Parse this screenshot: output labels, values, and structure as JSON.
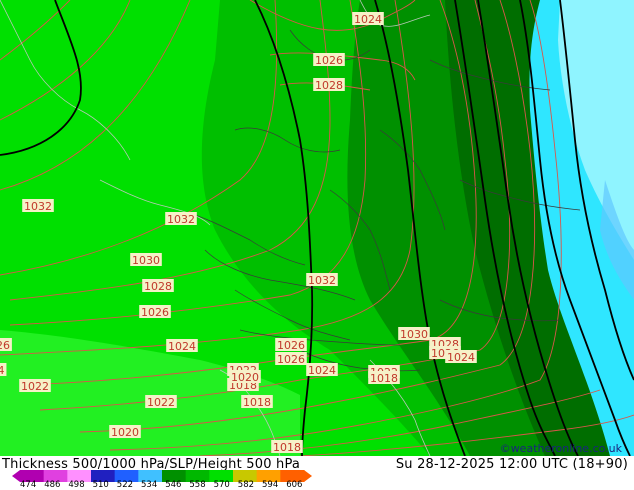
{
  "footer": {
    "left_title": "Thickness 500/1000 hPa/SLP/Height 500 hPa",
    "right_title": "Su 28-12-2025 12:00 UTC (18+90)",
    "credit": "©weatheronline.co.uk",
    "scale_ticks": [
      "474",
      "486",
      "498",
      "510",
      "522",
      "534",
      "546",
      "558",
      "570",
      "582",
      "594",
      "606"
    ],
    "scale_colors": [
      "#b000b0",
      "#e040e0",
      "#ff90ff",
      "#2020c0",
      "#2060ff",
      "#40c0ff",
      "#009000",
      "#00b800",
      "#00e000",
      "#c8c800",
      "#ffa000",
      "#ff6000"
    ]
  },
  "map": {
    "isobar_labels": [
      {
        "text": "1024",
        "key": "a"
      },
      {
        "text": "1026",
        "key": "b"
      },
      {
        "text": "1028",
        "key": "c"
      },
      {
        "text": "1032",
        "key": "d"
      },
      {
        "text": "1032",
        "key": "e"
      },
      {
        "text": "1030",
        "key": "f"
      },
      {
        "text": "1028",
        "key": "g"
      },
      {
        "text": "1026",
        "key": "h"
      },
      {
        "text": "1032",
        "key": "i"
      },
      {
        "text": "1024",
        "key": "j"
      },
      {
        "text": "1026",
        "key": "k"
      },
      {
        "text": "1026",
        "key": "l"
      },
      {
        "text": "1024",
        "key": "m"
      },
      {
        "text": "1022",
        "key": "n"
      },
      {
        "text": "1018",
        "key": "o"
      },
      {
        "text": "1022",
        "key": "p"
      },
      {
        "text": "1018",
        "key": "q"
      },
      {
        "text": "1020",
        "key": "r"
      },
      {
        "text": "1018",
        "key": "s"
      },
      {
        "text": "1022",
        "key": "t"
      },
      {
        "text": "1030",
        "key": "u"
      },
      {
        "text": "1028",
        "key": "v"
      },
      {
        "text": "1026",
        "key": "w"
      },
      {
        "text": "1024",
        "key": "x"
      },
      {
        "text": "1022",
        "key": "y"
      },
      {
        "text": "1020",
        "key": "z"
      },
      {
        "text": "1018",
        "key": "aa"
      },
      {
        "text": "26",
        "key": "ab"
      },
      {
        "text": "4",
        "key": "ac"
      }
    ],
    "colors": {
      "bright_green": "#00e000",
      "light_green": "#22f022",
      "mid_green": "#00b800",
      "dark_green": "#008800",
      "darker_green": "#006e00",
      "cyan": "#2fe6ff",
      "light_cyan": "#8ff4ff",
      "isobar": "#d9564a",
      "height_line": "#000000",
      "border": "#3a3a3a"
    }
  }
}
